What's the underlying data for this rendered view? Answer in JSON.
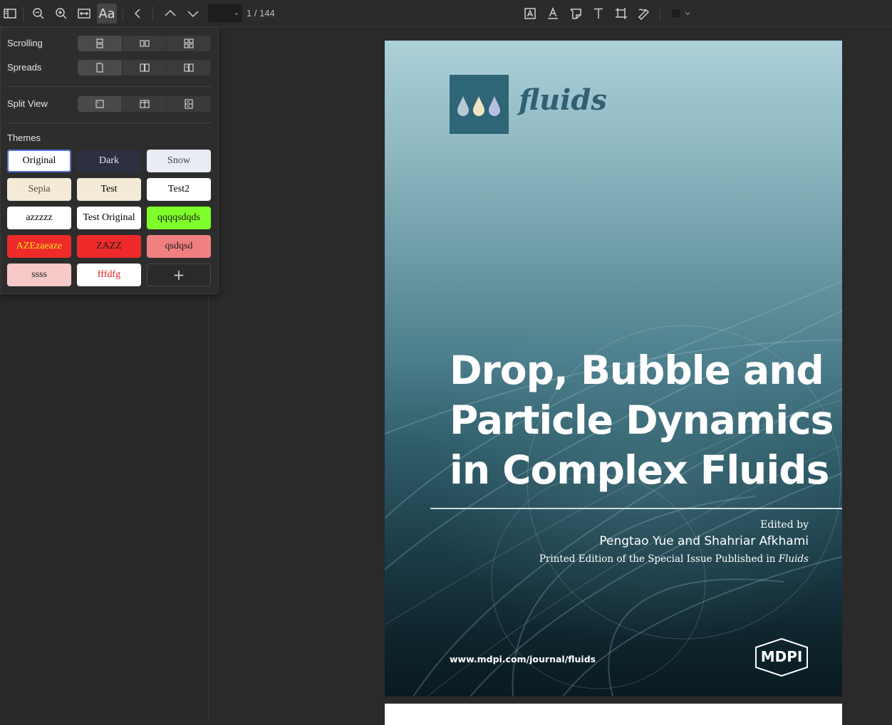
{
  "toolbar": {
    "page_input_value": "-",
    "page_count": "1 / 144",
    "font_button_label": "Aa"
  },
  "popover": {
    "scrolling_label": "Scrolling",
    "spreads_label": "Spreads",
    "split_view_label": "Split View",
    "themes_label": "Themes",
    "themes": [
      {
        "label": "Original",
        "bg": "#ffffff",
        "fg": "#000000"
      },
      {
        "label": "Dark",
        "bg": "#2c3040",
        "fg": "#e6e6e6"
      },
      {
        "label": "Snow",
        "bg": "#e9ecf2",
        "fg": "#3a3f4a"
      },
      {
        "label": "Sepia",
        "bg": "#f3ead8",
        "fg": "#5b4a33"
      },
      {
        "label": "Test",
        "bg": "#f3ead8",
        "fg": "#000000"
      },
      {
        "label": "Test2",
        "bg": "#ffffff",
        "fg": "#000000"
      },
      {
        "label": "azzzzz",
        "bg": "#ffffff",
        "fg": "#000000"
      },
      {
        "label": "Test Original",
        "bg": "#ffffff",
        "fg": "#000000"
      },
      {
        "label": "qqqqsdqds",
        "bg": "#7fff2a",
        "fg": "#1a1a1a"
      },
      {
        "label": "AZEzaeaze",
        "bg": "#ee2a2a",
        "fg": "#ffe21a"
      },
      {
        "label": "ZAZZ",
        "bg": "#ee2a2a",
        "fg": "#1a1a1a"
      },
      {
        "label": "qsdqsd",
        "bg": "#f08080",
        "fg": "#1a1a1a"
      },
      {
        "label": "ssss",
        "bg": "#f8c9c9",
        "fg": "#1a1a1a"
      },
      {
        "label": "fffdfg",
        "bg": "#ffffff",
        "fg": "#e02020"
      }
    ],
    "add_theme_label": "+"
  },
  "document": {
    "journal_logo": "fluids",
    "title": "Drop, Bubble and Particle Dynamics in Complex Fluids",
    "edited_by": "Edited by",
    "editors": "Pengtao Yue and Shahriar Afkhami",
    "printed_edition": "Printed Edition of the Special Issue Published in",
    "printed_journal": "Fluids",
    "url": "www.mdpi.com/journal/fluids",
    "publisher_logo": "MDPI"
  }
}
